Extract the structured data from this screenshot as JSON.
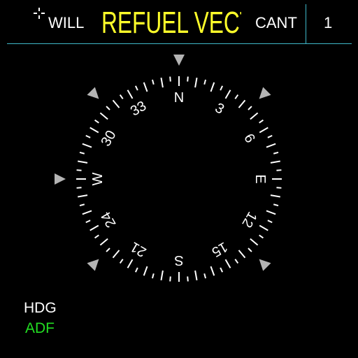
{
  "header": {
    "will_label": "WILL",
    "title": "REFUEL VECTOR",
    "cant_label": "CANT",
    "page_number": "1"
  },
  "compass": {
    "icon": "compass-rose",
    "labels": [
      {
        "heading": 0,
        "text": "N"
      },
      {
        "heading": 30,
        "text": "3"
      },
      {
        "heading": 60,
        "text": "6"
      },
      {
        "heading": 90,
        "text": "E"
      },
      {
        "heading": 120,
        "text": "12"
      },
      {
        "heading": 150,
        "text": "15"
      },
      {
        "heading": 180,
        "text": "S"
      },
      {
        "heading": 210,
        "text": "21"
      },
      {
        "heading": 240,
        "text": "24"
      },
      {
        "heading": 270,
        "text": "W"
      },
      {
        "heading": 300,
        "text": "30"
      },
      {
        "heading": 330,
        "text": "33"
      }
    ],
    "index_marks_deg": [
      0,
      45,
      135,
      225,
      270,
      315
    ]
  },
  "modes": {
    "hdg_label": "HDG",
    "adf_label": "ADF"
  },
  "colors": {
    "background": "#000000",
    "title": "#ffff2a",
    "text": "#ffffff",
    "divider": "#3fb7c9",
    "adf_active": "#22dd22",
    "index_marker": "#b4b4b4"
  }
}
